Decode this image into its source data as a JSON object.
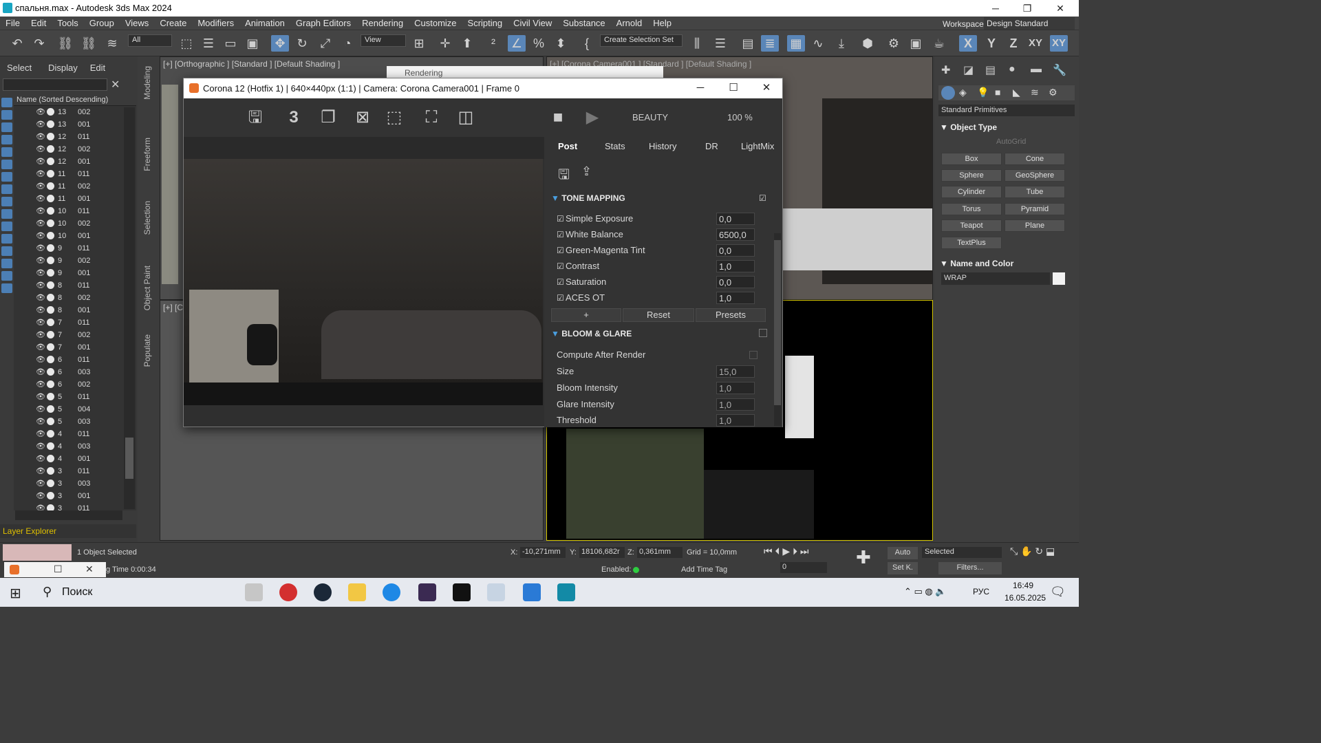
{
  "window": {
    "title": "спальня.max - Autodesk 3ds Max 2024",
    "minimize": "─",
    "maximize": "❐",
    "close": "✕"
  },
  "menu": [
    "File",
    "Edit",
    "Tools",
    "Group",
    "Views",
    "Create",
    "Modifiers",
    "Animation",
    "Graph Editors",
    "Rendering",
    "Customize",
    "Scripting",
    "Civil View",
    "Substance",
    "Arnold",
    "Help"
  ],
  "workspaces": {
    "label": "Workspaces:",
    "value": "Design Standard"
  },
  "toolbar": {
    "filter": "All",
    "refcoord": "View",
    "selset": "Create Selection Set",
    "axes": [
      "X",
      "Y",
      "Z",
      "XY",
      "XY"
    ]
  },
  "scene_explorer": {
    "tabs": [
      "Select",
      "Display",
      "Edit"
    ],
    "column_header": "Name (Sorted Descending)",
    "rows": [
      [
        "13",
        "002"
      ],
      [
        "13",
        "001"
      ],
      [
        "12",
        "011"
      ],
      [
        "12",
        "002"
      ],
      [
        "12",
        "001"
      ],
      [
        "11",
        "011"
      ],
      [
        "11",
        "002"
      ],
      [
        "11",
        "001"
      ],
      [
        "10",
        "011"
      ],
      [
        "10",
        "002"
      ],
      [
        "10",
        "001"
      ],
      [
        "9",
        "011"
      ],
      [
        "9",
        "002"
      ],
      [
        "9",
        "001"
      ],
      [
        "8",
        "011"
      ],
      [
        "8",
        "002"
      ],
      [
        "8",
        "001"
      ],
      [
        "7",
        "011"
      ],
      [
        "7",
        "002"
      ],
      [
        "7",
        "001"
      ],
      [
        "6",
        "011"
      ],
      [
        "6",
        "003"
      ],
      [
        "6",
        "002"
      ],
      [
        "5",
        "011"
      ],
      [
        "5",
        "004"
      ],
      [
        "5",
        "003"
      ],
      [
        "4",
        "011"
      ],
      [
        "4",
        "003"
      ],
      [
        "4",
        "001"
      ],
      [
        "3",
        "011"
      ],
      [
        "3",
        "003"
      ],
      [
        "3",
        "001"
      ],
      [
        "3",
        "011"
      ]
    ],
    "footer": "Layer Explorer"
  },
  "side_tabs": [
    "Modeling",
    "Freeform",
    "Selection",
    "Object Paint",
    "Populate"
  ],
  "viewports": {
    "top_left": "[+] [Orthographic ] [Standard ] [Default Shading ]",
    "top_right": "[+] [Corona Camera001 ] [Standard ] [Default Shading ]",
    "bottom_left": "[+] [C"
  },
  "rendering_stub": "Rendering",
  "corona": {
    "title": "Corona 12 (Hotfix 1) | 640×440px (1:1) | Camera: Corona Camera001 | Frame 0",
    "pass": "BEAUTY",
    "zoom": "100 %",
    "tabs": [
      "Post",
      "Stats",
      "History",
      "DR",
      "LightMix"
    ],
    "tone_mapping": {
      "title": "TONE MAPPING",
      "rows": [
        [
          "Simple Exposure",
          "0,0"
        ],
        [
          "White Balance",
          "6500,0"
        ],
        [
          "Green-Magenta Tint",
          "0,0"
        ],
        [
          "Contrast",
          "1,0"
        ],
        [
          "Saturation",
          "0,0"
        ],
        [
          "ACES OT",
          "1,0"
        ]
      ],
      "buttons": [
        "+",
        "Reset",
        "Presets"
      ]
    },
    "bloom": {
      "title": "BLOOM & GLARE",
      "rows": [
        [
          "Compute After Render",
          ""
        ],
        [
          "Size",
          "15,0"
        ],
        [
          "Bloom Intensity",
          "1,0"
        ],
        [
          "Glare Intensity",
          "1,0"
        ],
        [
          "Threshold",
          "1,0"
        ]
      ]
    }
  },
  "command_panel": {
    "dropdown": "Standard Primitives",
    "object_type": "Object Type",
    "autogrid": "AutoGrid",
    "buttons": [
      "Box",
      "Cone",
      "Sphere",
      "GeoSphere",
      "Cylinder",
      "Tube",
      "Torus",
      "Pyramid",
      "Teapot",
      "Plane",
      "TextPlus"
    ],
    "name_color": "Name and Color",
    "name_value": "WRAP"
  },
  "status": {
    "selected": "1 Object Selected",
    "render_time": "g Time  0:00:34",
    "x": "-10,271mm",
    "y": "18106,682r",
    "z": "0,361mm",
    "grid": "Grid = 10,0mm",
    "enabled": "Enabled:",
    "add_tag": "Add Time Tag",
    "auto": "Auto",
    "set_key": "Set K.",
    "selected_dd": "Selected",
    "filters": "Filters...",
    "frame": "0"
  },
  "taskbar": {
    "search": "Поиск",
    "lang": "РУС",
    "time": "16:49",
    "date": "16.05.2025"
  }
}
